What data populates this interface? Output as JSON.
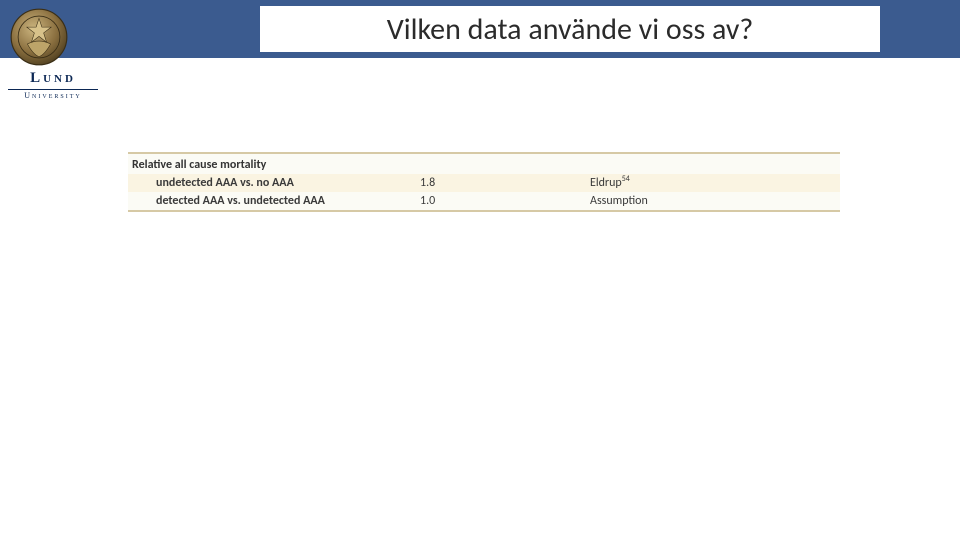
{
  "header": {
    "title": "Vilken data använde vi oss av?"
  },
  "logo": {
    "name": "Lund",
    "subline": "University"
  },
  "table": {
    "heading": "Relative all cause mortality",
    "rows": [
      {
        "label": "undetected AAA vs. no AAA",
        "value": "1.8",
        "source": "Eldrup",
        "sup": "54"
      },
      {
        "label": "detected AAA vs. undetected AAA",
        "value": "1.0",
        "source": "Assumption",
        "sup": ""
      }
    ]
  }
}
